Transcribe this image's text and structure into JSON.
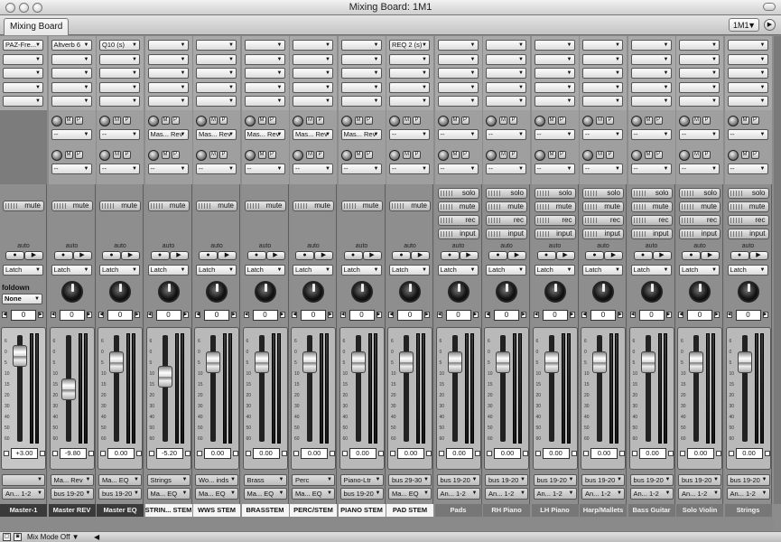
{
  "window": {
    "title": "Mixing Board: 1M1"
  },
  "tab": {
    "label": "Mixing Board"
  },
  "track_selector": {
    "value": "1M1"
  },
  "common": {
    "mute_label": "mute",
    "solo_label": "solo",
    "rec_label": "rec",
    "input_label": "input",
    "auto_label": "auto",
    "latch_label": "Latch",
    "send_empty": "--",
    "foldown_label": "foldown",
    "foldown_value": "None"
  },
  "strips": [
    {
      "name": "Master-1",
      "name_style": "dark",
      "insert1": "PAZ-Fre...",
      "insert5": "",
      "send1": "",
      "send2": "",
      "pan": "0",
      "level": "+3.00",
      "io1": "",
      "io2": "An... 1-2",
      "fader": 0.15,
      "kind": "master"
    },
    {
      "name": "Master REV",
      "name_style": "dark",
      "insert1": "Altverb 6",
      "insert5": "",
      "send1": "--",
      "send2": "--",
      "pan": "0",
      "level": "-9.80",
      "io1": "Ma... Rev",
      "io2": "bus 19-20",
      "fader": 0.52,
      "kind": "aux"
    },
    {
      "name": "Master EQ",
      "name_style": "dark",
      "insert1": "Q10 (s)",
      "insert5": "",
      "send1": "--",
      "send2": "--",
      "pan": "0",
      "level": "0.00",
      "io1": "Ma... EQ",
      "io2": "bus 19-20",
      "fader": 0.22,
      "kind": "aux"
    },
    {
      "name": "STRIN... STEM",
      "name_style": "light",
      "insert1": "",
      "insert5": "",
      "send1": "Mas... Rev",
      "send2": "--",
      "pan": "0",
      "level": "-5.20",
      "io1": "Strings",
      "io2": "Ma... EQ",
      "fader": 0.38,
      "kind": "aux"
    },
    {
      "name": "WWS STEM",
      "name_style": "light",
      "insert1": "",
      "insert5": "",
      "send1": "Mas... Rev",
      "send2": "--",
      "pan": "0",
      "level": "0.00",
      "io1": "Wo... inds",
      "io2": "Ma... EQ",
      "fader": 0.22,
      "kind": "aux"
    },
    {
      "name": "BRASSTEM",
      "name_style": "light",
      "insert1": "",
      "insert5": "",
      "send1": "Mas... Rev",
      "send2": "--",
      "pan": "0",
      "level": "0.00",
      "io1": "Brass",
      "io2": "Ma... EQ",
      "fader": 0.22,
      "kind": "aux"
    },
    {
      "name": "PERC/STEM",
      "name_style": "light",
      "insert1": "",
      "insert5": "",
      "send1": "Mas... Rev",
      "send2": "--",
      "pan": "0",
      "level": "0.00",
      "io1": "Perc",
      "io2": "Ma... EQ",
      "fader": 0.22,
      "kind": "aux"
    },
    {
      "name": "PIANO STEM",
      "name_style": "light",
      "insert1": "",
      "insert5": "",
      "send1": "Mas... Rev",
      "send2": "--",
      "pan": "0",
      "level": "0.00",
      "io1": "Piano-Ltr",
      "io2": "bus 19-20",
      "fader": 0.22,
      "kind": "aux"
    },
    {
      "name": "PAD STEM",
      "name_style": "light",
      "insert1": "REQ 2 (s)",
      "insert5": "",
      "send1": "--",
      "send2": "--",
      "pan": "0",
      "level": "0.00",
      "io1": "bus 29-30",
      "io2": "Ma... EQ",
      "fader": 0.22,
      "kind": "aux"
    },
    {
      "name": "Pads",
      "name_style": "grey",
      "insert1": "",
      "insert5": "",
      "send1": "--",
      "send2": "--",
      "pan": "0",
      "level": "0.00",
      "io1": "bus 19-20",
      "io2": "An... 1-2",
      "fader": 0.22,
      "kind": "track"
    },
    {
      "name": "RH Piano",
      "name_style": "grey",
      "insert1": "",
      "insert5": "",
      "send1": "--",
      "send2": "--",
      "pan": "0",
      "level": "0.00",
      "io1": "bus 19-20",
      "io2": "An... 1-2",
      "fader": 0.22,
      "kind": "track"
    },
    {
      "name": "LH Piano",
      "name_style": "grey",
      "insert1": "",
      "insert5": "",
      "send1": "--",
      "send2": "--",
      "pan": "0",
      "level": "0.00",
      "io1": "bus 19-20",
      "io2": "An... 1-2",
      "fader": 0.22,
      "kind": "track"
    },
    {
      "name": "Harp/Mallets",
      "name_style": "grey",
      "insert1": "",
      "insert5": "",
      "send1": "--",
      "send2": "--",
      "pan": "0",
      "level": "0.00",
      "io1": "bus 19-20",
      "io2": "An... 1-2",
      "fader": 0.22,
      "kind": "track"
    },
    {
      "name": "Bass Guitar",
      "name_style": "grey",
      "insert1": "",
      "insert5": "",
      "send1": "--",
      "send2": "--",
      "pan": "0",
      "level": "0.00",
      "io1": "bus 19-20",
      "io2": "An... 1-2",
      "fader": 0.22,
      "kind": "track"
    },
    {
      "name": "Solo Violin",
      "name_style": "grey",
      "insert1": "",
      "insert5": "",
      "send1": "--",
      "send2": "--",
      "pan": "0",
      "level": "0.00",
      "io1": "bus 19-20",
      "io2": "An... 1-2",
      "fader": 0.22,
      "kind": "track"
    },
    {
      "name": "Strings",
      "name_style": "grey",
      "insert1": "",
      "insert5": "",
      "send1": "--",
      "send2": "--",
      "pan": "0",
      "level": "0.00",
      "io1": "bus 19-20",
      "io2": "An... 1-2",
      "fader": 0.22,
      "kind": "track"
    }
  ],
  "scale_labels": [
    "6",
    "0",
    "5",
    "10",
    "15",
    "20",
    "30",
    "40",
    "50",
    "60"
  ],
  "statusbar": {
    "mix_mode": "Mix Mode Off"
  }
}
